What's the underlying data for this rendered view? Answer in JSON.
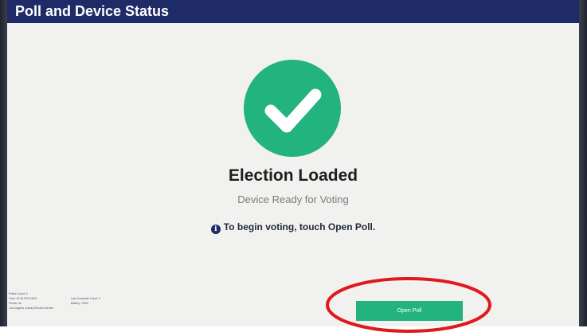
{
  "header": {
    "title": "Poll and Device Status"
  },
  "status": {
    "icon": "checkmark-icon",
    "title": "Election Loaded",
    "subtitle": "Device Ready for Voting",
    "instruction": "To begin voting, touch Open Poll."
  },
  "footer": {
    "rows": [
      {
        "left": "Public Count: 0",
        "right": ""
      },
      {
        "left": "Time: 01:05 PM 3/4/20",
        "right": "Last Computer Count: 0"
      },
      {
        "left": "Printer: ok",
        "right": "Battery: 100%"
      },
      {
        "left": "Los Angeles County Election Device",
        "right": ""
      }
    ]
  },
  "actions": {
    "open_poll_label": "Open Poll"
  },
  "colors": {
    "header_bg": "#1f2b67",
    "success_green": "#23b37f",
    "screen_bg": "#f1f2f0",
    "annotation_red": "#e01a1a"
  }
}
